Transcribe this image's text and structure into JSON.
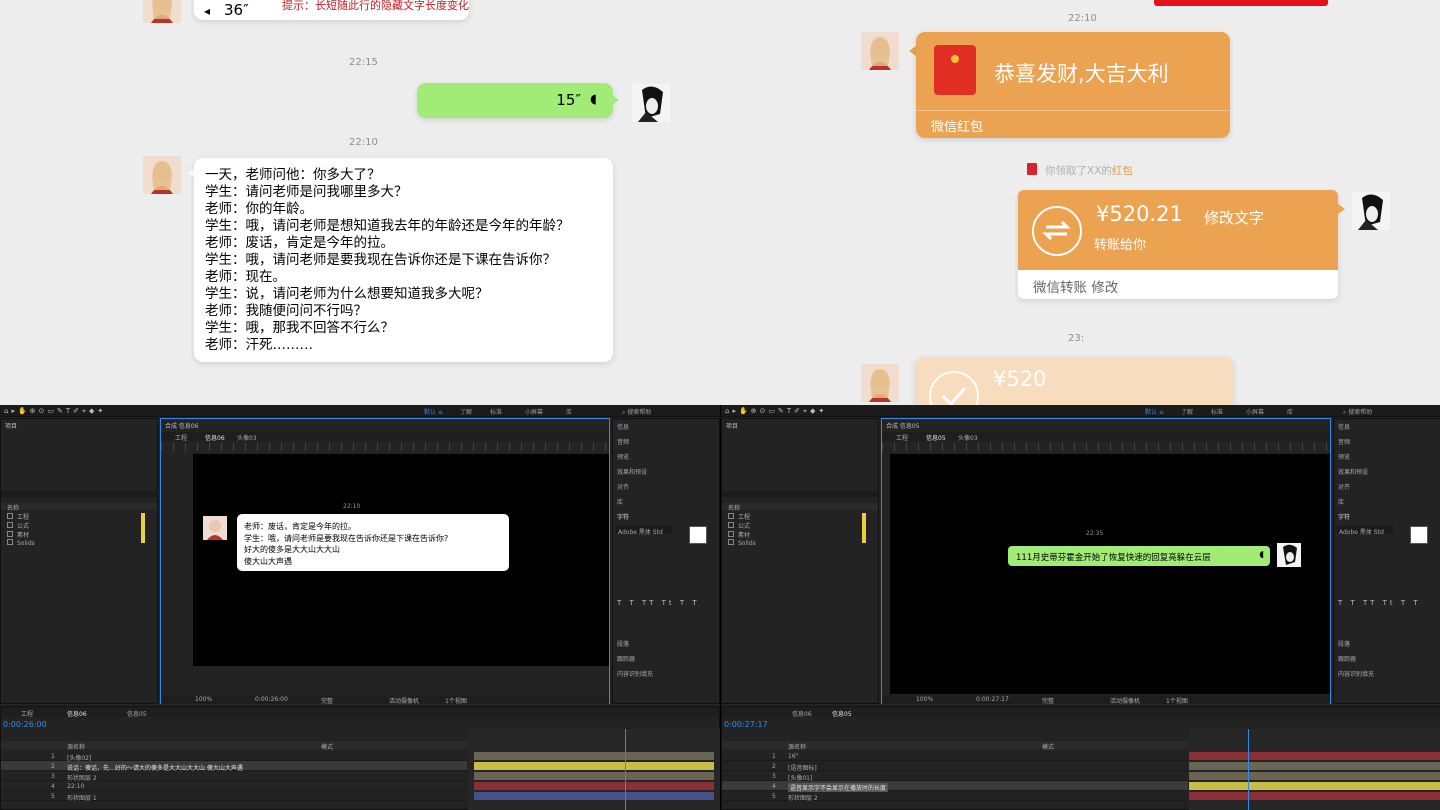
{
  "chat": {
    "left": {
      "voice_top": "36″",
      "tip": "提示：长短随此行的隐藏文字长度变化",
      "time1": "22:15",
      "voice_out": "15″",
      "time2": "22:10",
      "joke": [
        "一天，老师问他：你多大了？",
        "学生：请问老师是问我哪里多大？",
        "老师：你的年龄。",
        "学生：哦，请问老师是想知道我去年的年龄还是今年的年龄？",
        "老师：废话，肯定是今年的拉。",
        "学生：哦，请问老师是要我现在告诉你还是下课在告诉你？",
        "老师：现在。",
        "学生：说，请问老师为什么想要知道我多大呢？",
        "老师：我随便问问不行吗？",
        "学生：哦，那我不回答不行么？",
        "老师：汗死………"
      ]
    },
    "right": {
      "time1": "22:10",
      "redpacket_title": "恭喜发财,大吉大利",
      "redpacket_label": "微信红包",
      "notice_prefix": "你领取了XX的",
      "notice_link": "红包",
      "transfer_amount": "¥520.21",
      "transfer_edit": "修改文字",
      "transfer_sub": "转账给你",
      "transfer_label": "微信转账 修改",
      "time2": "23:",
      "received_amount": "¥520"
    }
  },
  "ae_left": {
    "project": "项目",
    "comp_tab": "合成 信息06",
    "viewer_tabs": [
      "工程",
      "信息06",
      "头像03"
    ],
    "time_label": "22:10",
    "bubble_lines": [
      "老师：废话，肯定是今年的拉。",
      "学生：哦，请问老师是要我现在告诉你还是下课在告诉你?",
      "好大的傻多是大大山大大山",
      "傻大山大声遇"
    ],
    "files": [
      "工程",
      "公式",
      "素材",
      "Solids"
    ],
    "timecode": "0:00:26:00",
    "timeline_tabs": [
      "工程",
      "信息06",
      "信息05"
    ],
    "layers": [
      {
        "num": "1",
        "name": "[头像02]"
      },
      {
        "num": "2",
        "name": "说话：傻话，先…好的～请大的傻多是大大山大大山 傻大山大声遇"
      },
      {
        "num": "3",
        "name": "形状图层 2"
      },
      {
        "num": "4",
        "name": "22:10"
      },
      {
        "num": "5",
        "name": "形状图层 1"
      }
    ],
    "right_panels": [
      "信息",
      "音频",
      "预览",
      "效果和预设",
      "对齐",
      "库",
      "字符"
    ],
    "font": "Adobe 黑体 Std",
    "zoom": "100%",
    "quality": "完整",
    "camera": "活动摄像机",
    "views": "1个视图",
    "extra": [
      "段落",
      "跟踪器",
      "内容识别填充"
    ]
  },
  "ae_right": {
    "project": "项目",
    "comp_tab": "合成 信息05",
    "viewer_tabs": [
      "工程",
      "信息05",
      "头像03"
    ],
    "time_label": "22:35",
    "bubble_text": "111月史蒂芬霍金开始了恢复快速的回复亮躲在云层",
    "voice_hint": "\"",
    "files": [
      "工程",
      "公式",
      "素材",
      "Solids"
    ],
    "timecode": "0:00:27:17",
    "timeline_tabs": [
      "信息06",
      "信息05"
    ],
    "layers": [
      {
        "num": "1",
        "name": "16\""
      },
      {
        "num": "2",
        "name": "[语音图标]"
      },
      {
        "num": "3",
        "name": "[头像01]"
      },
      {
        "num": "4",
        "name": "语音显示字不会显示在播放时的长度"
      },
      {
        "num": "5",
        "name": "形状图层 2"
      }
    ],
    "right_panels": [
      "信息",
      "音频",
      "预览",
      "效果和预设",
      "对齐",
      "库",
      "字符"
    ],
    "font": "Adobe 黑体 Std",
    "zoom": "100%",
    "quality": "完整",
    "camera": "活动摄像机",
    "views": "1个视图",
    "extra": [
      "段落",
      "跟踪器",
      "内容识别填充"
    ]
  },
  "colors": {
    "chat_bg": "#ededed",
    "green_bubble": "#a0ec76",
    "orange": "#eba352",
    "ae_bg": "#232323",
    "accent": "#2d8ceb"
  }
}
